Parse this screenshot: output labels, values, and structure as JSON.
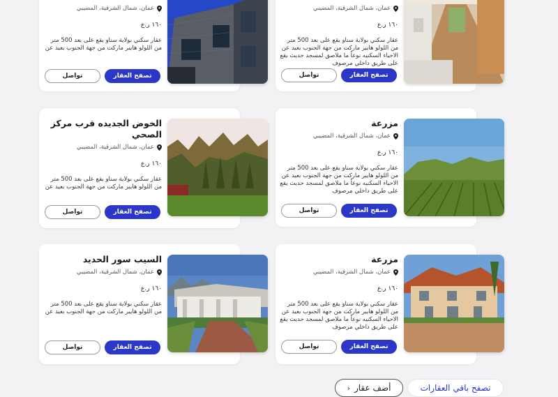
{
  "cards": [
    {
      "title": "",
      "location": "عمان، شمال الشرقية، المضيبي",
      "price": "١٦٠ ر.ع",
      "description": "عقار سكني بولاية سناو يقع على بعد 500 متر من اللولو هايبر ماركت من جهة الجنوب بعيد عن",
      "browse_label": "تصفح العقار",
      "contact_label": "تواصل"
    },
    {
      "title": "",
      "location": "عمان، شمال الشرقية، المضيبي",
      "price": "١٦٠ ر.ع",
      "description": "عقار سكني بولاية سناو يقع على بعد 500 متر من اللولو هايبر ماركت من جهة الجنوب بعيد عن الاحياء السكنيه نوعاً ما ملاصق لمسجد حديث يقع على طريق داخلي مرصوف",
      "browse_label": "تصفح العقار",
      "contact_label": "تواصل"
    },
    {
      "title": "الخوض الجديده قرب مركز الصحي",
      "location": "عمان، شمال الشرقية، المضيبي",
      "price": "١٦٠ ر.ع",
      "description": "عقار سكني بولاية سناو يقع على بعد 500 متر من اللولو هايبر ماركت من جهة الجنوب بعيد عن",
      "browse_label": "تصفح العقار",
      "contact_label": "تواصل"
    },
    {
      "title": "مزرعة",
      "location": "عمان، شمال الشرقية، المضيبي",
      "price": "١٦٠ ر.ع",
      "description": "عقار سكني بولاية سناو يقع على بعد 500 متر من اللولو هايبر ماركت من جهة الجنوب بعيد عن الاحياء السكنيه نوعاً ما ملاصق لمسجد حديث يقع على طريق داخلي مرصوف",
      "browse_label": "تصفح العقار",
      "contact_label": "تواصل"
    },
    {
      "title": "السيب سور الحديد",
      "location": "عمان، شمال الشرقية، المضيبي",
      "price": "١٦٠ ر.ع",
      "description": "عقار سكني بولاية سناو يقع على بعد 500 متر من اللولو هايبر ماركت من جهة الجنوب بعيد عن",
      "browse_label": "تصفح العقار",
      "contact_label": "تواصل"
    },
    {
      "title": "مزرعة",
      "location": "عمان، شمال الشرقية، المضيبي",
      "price": "١٦٠ ر.ع",
      "description": "عقار سكني بولاية سناو يقع على بعد 500 متر من اللولو هايبر ماركت من جهة الجنوب بعيد عن الاحياء السكنيه نوعاً ما ملاصق لمسجد حديث يقع على طريق داخلي مرصوف",
      "browse_label": "تصفح العقار",
      "contact_label": "تواصل"
    }
  ],
  "footer": {
    "add_property_label": "أضف عقار",
    "browse_all_label": "تصفح باقي العقارات"
  },
  "colors": {
    "primary": "#2a37c7",
    "background": "#f2f2f4"
  },
  "icons": {
    "location": "map-pin-icon",
    "add": "chevron-left-icon"
  }
}
